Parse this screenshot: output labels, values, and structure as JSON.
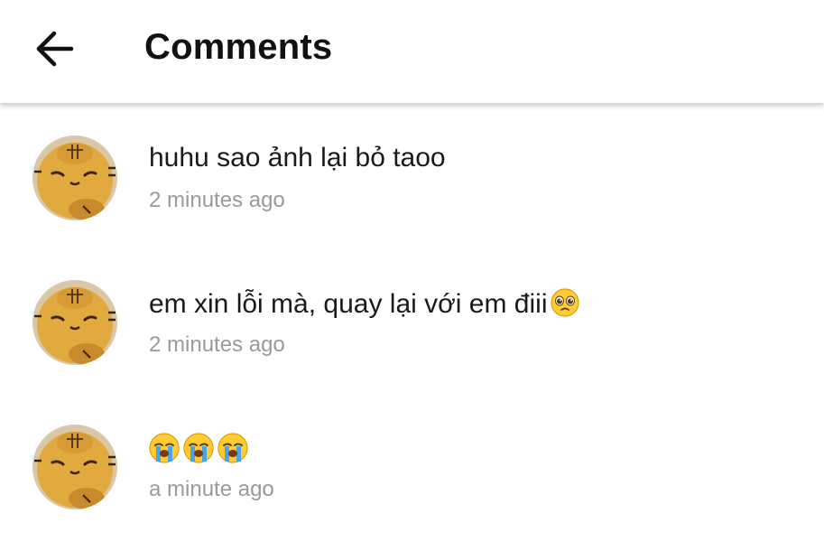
{
  "header": {
    "title": "Comments",
    "back_icon": "arrow-left-icon"
  },
  "comments": [
    {
      "text": "huhu sao ảnh lại bỏ taoo",
      "time": "2 minutes ago",
      "avatar_icon": "tiger-plush-avatar"
    },
    {
      "text": "em xin lỗi mà, quay lại với em điii",
      "emoji": "pleading-face-icon",
      "time": "2 minutes ago",
      "avatar_icon": "tiger-plush-avatar"
    },
    {
      "emojis": [
        "loudly-crying-face-icon",
        "loudly-crying-face-icon",
        "loudly-crying-face-icon"
      ],
      "time": "a minute ago",
      "avatar_icon": "tiger-plush-avatar"
    }
  ],
  "colors": {
    "text": "#1a1a1a",
    "timestamp": "#9a9a9a",
    "avatar": "#e2a93f",
    "emoji": "#ffcc33",
    "tears": "#4aa3e6"
  }
}
